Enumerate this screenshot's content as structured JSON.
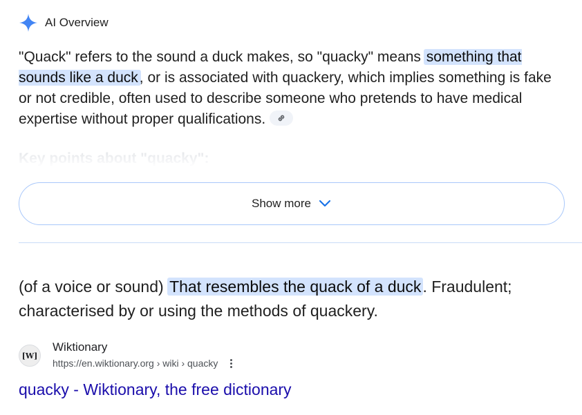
{
  "ai_overview": {
    "title": "AI Overview",
    "icon": "sparkle-icon",
    "accent_color": "#4285f4",
    "text_before": "\"Quack\" refers to the sound a duck makes, so \"quacky\" means ",
    "highlight": "something that sounds like a duck",
    "text_after": ", or is associated with quackery, which implies something is fake or not credible, often used to describe someone who pretends to have medical expertise without proper qualifications.",
    "link_icon": "link-icon",
    "faded_heading": "Key points about \"quacky\":",
    "show_more_label": "Show more",
    "highlight_color": "#d3e3fd"
  },
  "definition": {
    "prefix": "(of a voice or sound) ",
    "highlight": "That resembles the quack of a duck",
    "suffix": ". Fraudulent; characterised by or using the methods of quackery."
  },
  "source": {
    "favicon_text": "[W]",
    "site_name": "Wiktionary",
    "url": "https://en.wiktionary.org › wiki › quacky",
    "more_icon": "more-vert-icon"
  },
  "result": {
    "title": "quacky - Wiktionary, the free dictionary",
    "link_color": "#1a0dab"
  }
}
